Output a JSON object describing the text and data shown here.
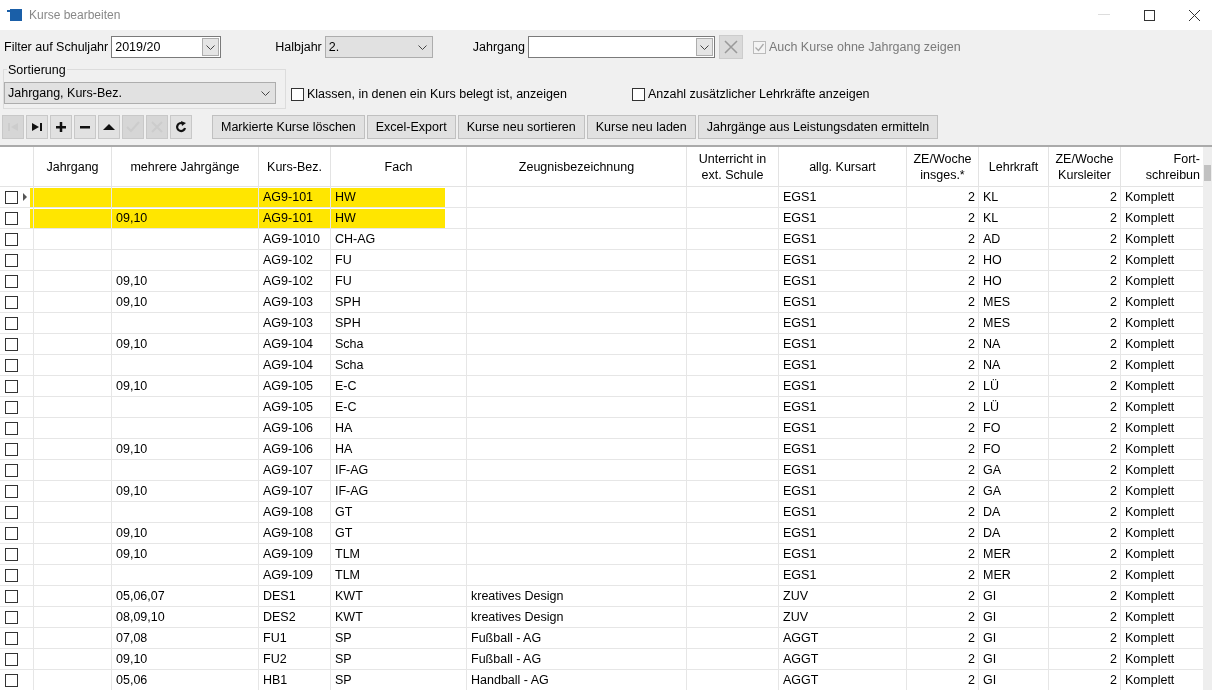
{
  "window": {
    "title": "Kurse bearbeiten"
  },
  "filter": {
    "schuljahr_label": "Filter auf Schuljahr",
    "schuljahr": "2019/20",
    "halbjahr_label": "Halbjahr",
    "halbjahr": "2.",
    "jahrgang_label": "Jahrgang",
    "clear_disabled": true,
    "ohne_jahrgang": {
      "label": "Auch Kurse ohne Jahrgang zeigen",
      "checked": true,
      "disabled": true
    }
  },
  "sortierung": {
    "label": "Sortierung",
    "value": "Jahrgang, Kurs-Bez."
  },
  "options": [
    {
      "label": "Klassen, in denen ein Kurs belegt ist, anzeigen",
      "checked": false
    },
    {
      "label": "Anzahl zusätzlicher Lehrkräfte anzeigen",
      "checked": false
    }
  ],
  "nav_buttons": [
    {
      "kind": "first",
      "disabled": true
    },
    {
      "kind": "last",
      "disabled": false
    },
    {
      "kind": "add",
      "disabled": false
    },
    {
      "kind": "delete",
      "disabled": false
    },
    {
      "kind": "up",
      "disabled": false
    },
    {
      "kind": "confirm",
      "disabled": true
    },
    {
      "kind": "cancel",
      "disabled": true
    },
    {
      "kind": "refresh",
      "disabled": false
    }
  ],
  "buttons": [
    "Markierte Kurse löschen",
    "Excel-Export",
    "Kurse neu sortieren",
    "Kurse neu laden",
    "Jahrgänge aus Leistungsdaten ermitteln"
  ],
  "table": {
    "columns": [
      "Jahrgang",
      "mehrere Jahrgänge",
      "Kurs-Bez.",
      "Fach",
      "Zeugnisbezeichnung",
      "Unterricht in\next. Schule",
      "allg. Kursart",
      "ZE/Woche\ninsges.*",
      "Lehrkraft",
      "ZE/Woche\nKursleiter",
      "Fort-\nschreibun"
    ],
    "rows": [
      {
        "checked": false,
        "current": true,
        "highlighted": true,
        "cells": [
          "",
          "",
          "AG9-101",
          "HW",
          "",
          "",
          "EGS1",
          "2",
          "KL",
          "2",
          "Komplett"
        ]
      },
      {
        "checked": false,
        "current": false,
        "highlighted": true,
        "cells": [
          "",
          "09,10",
          "AG9-101",
          "HW",
          "",
          "",
          "EGS1",
          "2",
          "KL",
          "2",
          "Komplett"
        ]
      },
      {
        "checked": false,
        "current": false,
        "highlighted": false,
        "cells": [
          "",
          "",
          "AG9-1010",
          "CH-AG",
          "",
          "",
          "EGS1",
          "2",
          "AD",
          "2",
          "Komplett"
        ]
      },
      {
        "checked": false,
        "current": false,
        "highlighted": false,
        "cells": [
          "",
          "",
          "AG9-102",
          "FU",
          "",
          "",
          "EGS1",
          "2",
          "HO",
          "2",
          "Komplett"
        ]
      },
      {
        "checked": false,
        "current": false,
        "highlighted": false,
        "cells": [
          "",
          "09,10",
          "AG9-102",
          "FU",
          "",
          "",
          "EGS1",
          "2",
          "HO",
          "2",
          "Komplett"
        ]
      },
      {
        "checked": false,
        "current": false,
        "highlighted": false,
        "cells": [
          "",
          "09,10",
          "AG9-103",
          "SPH",
          "",
          "",
          "EGS1",
          "2",
          "MES",
          "2",
          "Komplett"
        ]
      },
      {
        "checked": false,
        "current": false,
        "highlighted": false,
        "cells": [
          "",
          "",
          "AG9-103",
          "SPH",
          "",
          "",
          "EGS1",
          "2",
          "MES",
          "2",
          "Komplett"
        ]
      },
      {
        "checked": false,
        "current": false,
        "highlighted": false,
        "cells": [
          "",
          "09,10",
          "AG9-104",
          "Scha",
          "",
          "",
          "EGS1",
          "2",
          "NA",
          "2",
          "Komplett"
        ]
      },
      {
        "checked": false,
        "current": false,
        "highlighted": false,
        "cells": [
          "",
          "",
          "AG9-104",
          "Scha",
          "",
          "",
          "EGS1",
          "2",
          "NA",
          "2",
          "Komplett"
        ]
      },
      {
        "checked": false,
        "current": false,
        "highlighted": false,
        "cells": [
          "",
          "09,10",
          "AG9-105",
          "E-C",
          "",
          "",
          "EGS1",
          "2",
          "LÜ",
          "2",
          "Komplett"
        ]
      },
      {
        "checked": false,
        "current": false,
        "highlighted": false,
        "cells": [
          "",
          "",
          "AG9-105",
          "E-C",
          "",
          "",
          "EGS1",
          "2",
          "LÜ",
          "2",
          "Komplett"
        ]
      },
      {
        "checked": false,
        "current": false,
        "highlighted": false,
        "cells": [
          "",
          "",
          "AG9-106",
          "HA",
          "",
          "",
          "EGS1",
          "2",
          "FO",
          "2",
          "Komplett"
        ]
      },
      {
        "checked": false,
        "current": false,
        "highlighted": false,
        "cells": [
          "",
          "09,10",
          "AG9-106",
          "HA",
          "",
          "",
          "EGS1",
          "2",
          "FO",
          "2",
          "Komplett"
        ]
      },
      {
        "checked": false,
        "current": false,
        "highlighted": false,
        "cells": [
          "",
          "",
          "AG9-107",
          "IF-AG",
          "",
          "",
          "EGS1",
          "2",
          "GA",
          "2",
          "Komplett"
        ]
      },
      {
        "checked": false,
        "current": false,
        "highlighted": false,
        "cells": [
          "",
          "09,10",
          "AG9-107",
          "IF-AG",
          "",
          "",
          "EGS1",
          "2",
          "GA",
          "2",
          "Komplett"
        ]
      },
      {
        "checked": false,
        "current": false,
        "highlighted": false,
        "cells": [
          "",
          "",
          "AG9-108",
          "GT",
          "",
          "",
          "EGS1",
          "2",
          "DA",
          "2",
          "Komplett"
        ]
      },
      {
        "checked": false,
        "current": false,
        "highlighted": false,
        "cells": [
          "",
          "09,10",
          "AG9-108",
          "GT",
          "",
          "",
          "EGS1",
          "2",
          "DA",
          "2",
          "Komplett"
        ]
      },
      {
        "checked": false,
        "current": false,
        "highlighted": false,
        "cells": [
          "",
          "09,10",
          "AG9-109",
          "TLM",
          "",
          "",
          "EGS1",
          "2",
          "MER",
          "2",
          "Komplett"
        ]
      },
      {
        "checked": false,
        "current": false,
        "highlighted": false,
        "cells": [
          "",
          "",
          "AG9-109",
          "TLM",
          "",
          "",
          "EGS1",
          "2",
          "MER",
          "2",
          "Komplett"
        ]
      },
      {
        "checked": false,
        "current": false,
        "highlighted": false,
        "cells": [
          "",
          "05,06,07",
          "DES1",
          "KWT",
          "kreatives Design",
          "",
          "ZUV",
          "2",
          "GI",
          "2",
          "Komplett"
        ]
      },
      {
        "checked": false,
        "current": false,
        "highlighted": false,
        "cells": [
          "",
          "08,09,10",
          "DES2",
          "KWT",
          "kreatives Design",
          "",
          "ZUV",
          "2",
          "GI",
          "2",
          "Komplett"
        ]
      },
      {
        "checked": false,
        "current": false,
        "highlighted": false,
        "cells": [
          "",
          "07,08",
          "FU1",
          "SP",
          "Fußball - AG",
          "",
          "AGGT",
          "2",
          "GI",
          "2",
          "Komplett"
        ]
      },
      {
        "checked": false,
        "current": false,
        "highlighted": false,
        "cells": [
          "",
          "09,10",
          "FU2",
          "SP",
          "Fußball - AG",
          "",
          "AGGT",
          "2",
          "GI",
          "2",
          "Komplett"
        ]
      },
      {
        "checked": false,
        "current": false,
        "highlighted": false,
        "cells": [
          "",
          "05,06",
          "HB1",
          "SP",
          "Handball - AG",
          "",
          "AGGT",
          "2",
          "GI",
          "2",
          "Komplett"
        ]
      }
    ]
  }
}
